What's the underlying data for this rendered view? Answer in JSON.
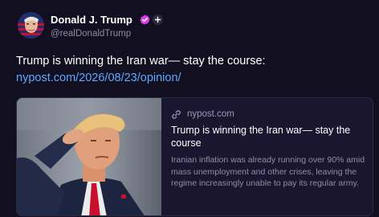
{
  "author": {
    "name": "Donald J. Trump",
    "handle": "@realDonaldTrump",
    "verified_color": "#d93cf2"
  },
  "post": {
    "text": "Trump is winning the Iran war— stay the course:",
    "link": "nypost.com/2026/08/23/opinion/"
  },
  "card": {
    "domain": "nypost.com",
    "title": "Trump is winning the Iran war— stay the course",
    "description": "Iranian inflation was already running over 90% amid mass unemployment and other crises, leaving the regime increasingly unable to pay its regular army."
  },
  "icons": {
    "verified": "verified-check-icon",
    "affiliation": "plus-badge-icon",
    "link": "link-chain-icon"
  },
  "colors": {
    "background": "#120f20",
    "link": "#5ea8ff",
    "card_border": "#2e2a45"
  }
}
